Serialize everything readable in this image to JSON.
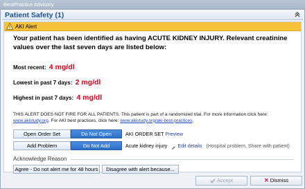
{
  "window": {
    "title": "BestPractice Advisory"
  },
  "section": {
    "title": "Patient Safety (1)"
  },
  "alert": {
    "label": "AKI Alert",
    "headline": "Your patient has been identified as having ACUTE KIDNEY INJURY. Relevant creatinine values over the last seven days are listed below:",
    "metrics": [
      {
        "label": "Most recent:",
        "value": "4 mg/dl"
      },
      {
        "label": "Lowest in past 7 days:",
        "value": "2 mg/dl"
      },
      {
        "label": "Highest in past 7 days:",
        "value": "4 mg/dl"
      }
    ],
    "notice_text_1": "THIS ALERT DOES NOT FIRE FOR ALL PATIENTS. This patient is part of a randomized trial. For more information click here:",
    "notice_link_1": "www.akistudy.org",
    "notice_text_2": ". For AKI best practices, click here:",
    "notice_link_2": "www.akistudy.org/aki-best-practices",
    "notice_text_3": "."
  },
  "actions": {
    "order_set": {
      "button_label": "Open Order Set",
      "toggle_label": "Do Not Open",
      "item_label": "AKI ORDER SET",
      "preview_label": "Preview"
    },
    "problem": {
      "button_label": "Add Problem",
      "toggle_label": "Do Not Add",
      "item_label": "Acute kidney injury",
      "edit_label": "Edit details",
      "detail_text": "(Hospital problem, Share with patient)"
    }
  },
  "acknowledge": {
    "title": "Acknowledge Reason",
    "options": [
      "Agree - Do not alert me for 48 hours",
      "Disagree with alert because..."
    ]
  },
  "footer": {
    "accept_label": "Accept",
    "dismiss_label": "Dismiss"
  },
  "colors": {
    "alert_bar": "#f6c23a",
    "value_red": "#e0001b",
    "selected_blue": "#2d6fc7",
    "title_blue": "#1f4f8f"
  }
}
